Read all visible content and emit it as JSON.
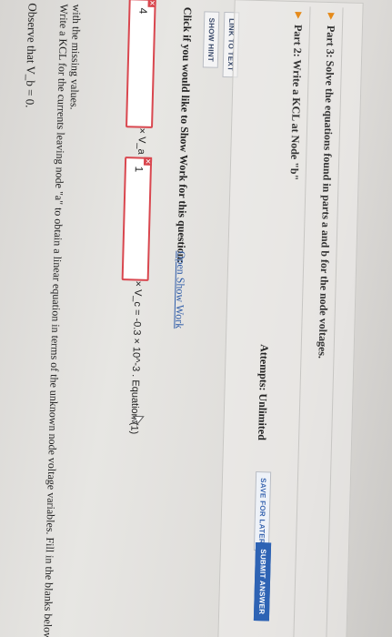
{
  "observe": "Observe that V_b = 0.",
  "instructions": [
    "Write a KCL for the currents leaving node \"a\" to obtain a linear equation in terms of the unknown node voltage variables. Fill in the blanks below",
    "with the missing values."
  ],
  "equation": {
    "answer1": "4",
    "answer2": "1",
    "coef1_text": "× V_a +",
    "coef2_text": "× V_c = -0.3 × 10^-3 . Equation (1)"
  },
  "show_work": {
    "prompt": "Click if you would like to Show Work for this question:",
    "link": "Open Show Work"
  },
  "buttons": {
    "show_hint": "SHOW HINT",
    "link_to_text": "LINK TO TEXT",
    "save_for_later": "SAVE FOR LATER",
    "submit_answer": "SUBMIT ANSWER"
  },
  "attempts": "Attempts: Unlimited",
  "parts": [
    "Part 2: Write a KCL at Node \"b\"",
    "Part 3: Solve the equations found in parts a and b for the node voltages."
  ],
  "colors": {
    "error_border": "#d9474f",
    "link": "#2f5ca8",
    "submit_bg": "#2e63b4",
    "part_arrow": "#e58a1a"
  }
}
